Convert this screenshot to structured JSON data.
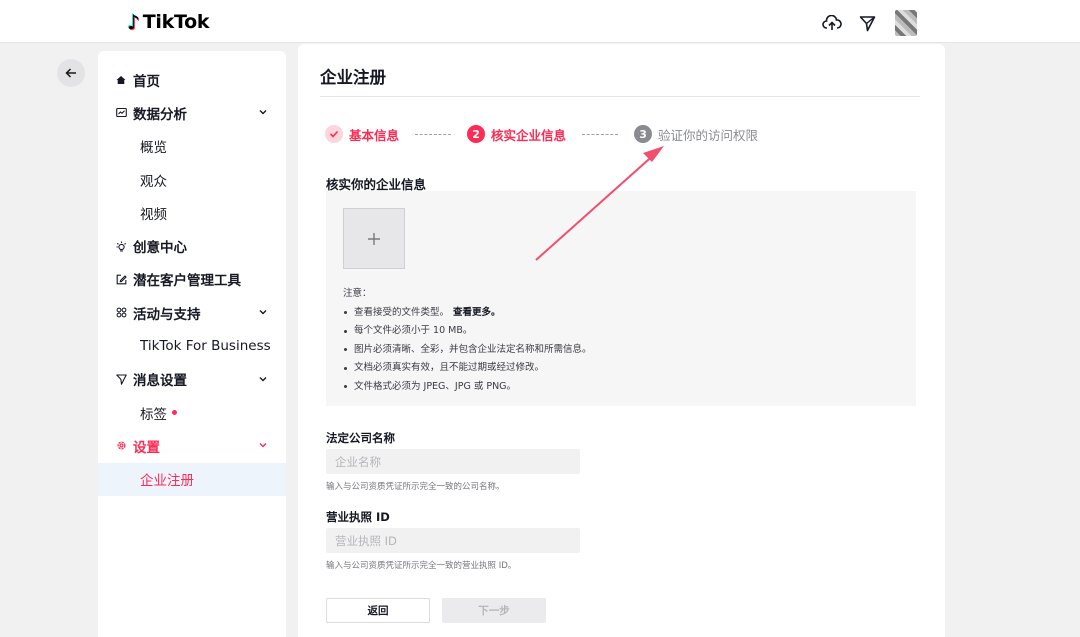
{
  "header": {
    "brand": "TikTok",
    "icons": [
      "cloud-upload-icon",
      "send-icon"
    ]
  },
  "sidebar": {
    "items": [
      {
        "label": "首页",
        "icon": "home-icon"
      },
      {
        "label": "数据分析",
        "icon": "chart-icon",
        "expandable": true
      },
      {
        "label": "概览"
      },
      {
        "label": "观众"
      },
      {
        "label": "视频"
      },
      {
        "label": "创意中心",
        "icon": "bulb-icon"
      },
      {
        "label": "潜在客户管理工具",
        "icon": "edit-icon"
      },
      {
        "label": "活动与支持",
        "icon": "grid-icon",
        "expandable": true
      },
      {
        "label": "TikTok For Business"
      },
      {
        "label": "消息设置",
        "icon": "send-icon",
        "expandable": true
      },
      {
        "label": "标签"
      },
      {
        "label": "设置",
        "icon": "gear-icon",
        "expandable": true
      },
      {
        "label": "企业注册"
      }
    ]
  },
  "main": {
    "title": "企业注册",
    "steps": [
      {
        "label": "基本信息",
        "state": "done"
      },
      {
        "number": "2",
        "label": "核实企业信息",
        "state": "current"
      },
      {
        "number": "3",
        "label": "验证你的访问权限",
        "state": "todo"
      }
    ],
    "section_title": "核实你的企业信息",
    "notes": {
      "heading": "注意：",
      "items": [
        "查看接受的文件类型。",
        "每个文件必须小于 10 MB。",
        "图片必须清晰、全彩，并包含企业法定名称和所需信息。",
        "文档必须真实有效，且不能过期或经过修改。",
        "文件格式必须为 JPEG、JPG 或 PNG。"
      ],
      "more_link": "查看更多。"
    },
    "company_field": {
      "label": "法定公司名称",
      "placeholder": "企业名称",
      "value": "",
      "helper": "输入与公司资质凭证所示完全一致的公司名称。"
    },
    "license_field": {
      "label": "营业执照 ID",
      "placeholder": "营业执照 ID",
      "value": "",
      "helper": "输入与公司资质凭证所示完全一致的营业执照 ID。"
    },
    "buttons": {
      "back": "返回",
      "next": "下一步"
    }
  },
  "colors": {
    "accent": "#fe2c55",
    "annotation_arrow": "#f0506e"
  }
}
